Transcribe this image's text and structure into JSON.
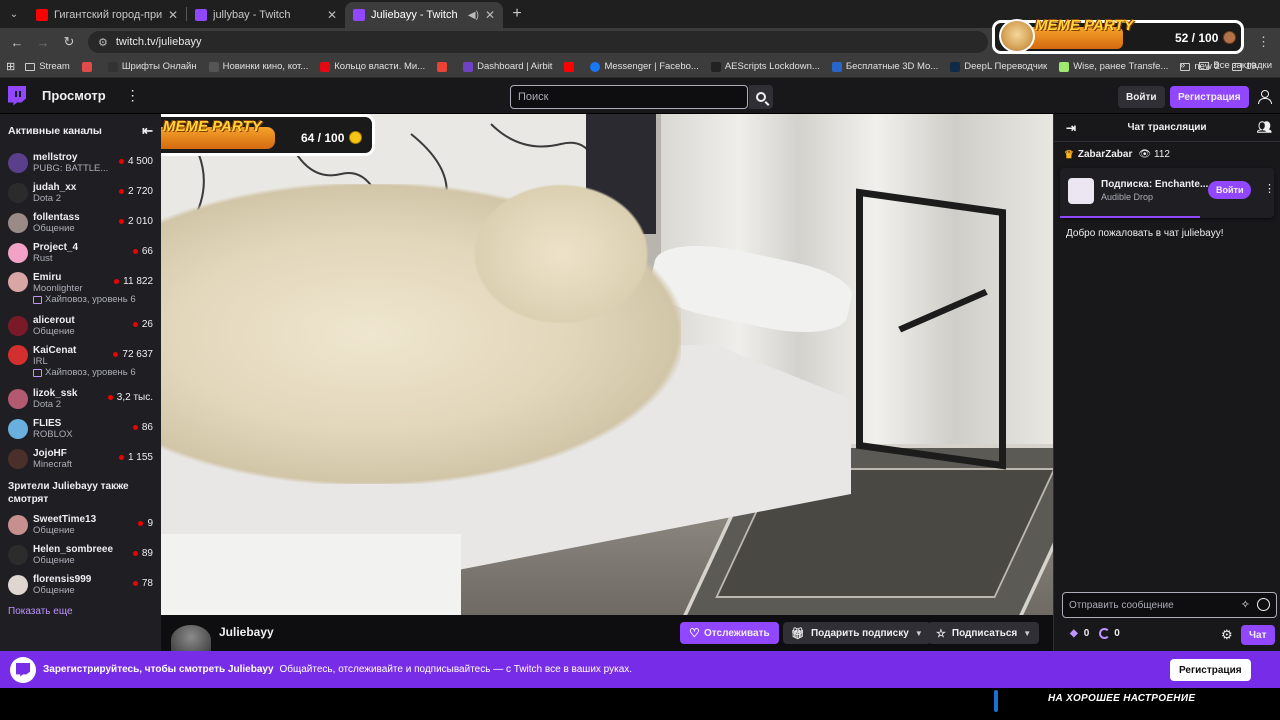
{
  "browser": {
    "tabs": [
      {
        "title": "Гигантский город-призрак СС",
        "favicon_color": "#ff0000",
        "active": false
      },
      {
        "title": "jullybay - Twitch",
        "favicon_color": "#9147ff",
        "active": false
      },
      {
        "title": "Juliebayy - Twitch",
        "favicon_color": "#9147ff",
        "active": true
      }
    ],
    "url": "twitch.tv/juliebayy",
    "bookmarks": [
      {
        "label": "Stream",
        "icon": "folder-icon"
      },
      {
        "label": "",
        "icon": "bookmark-icon",
        "color": "#e34b4b"
      },
      {
        "label": "Шрифты Онлайн",
        "icon": "bookmark-icon",
        "color": "#333333"
      },
      {
        "label": "Новинки кино, кот...",
        "icon": "bookmark-icon",
        "color": "#555555"
      },
      {
        "label": "Кольцо власти. Ми...",
        "icon": "bookmark-icon",
        "color": "#e50914"
      },
      {
        "label": "",
        "icon": "gmail-icon",
        "color": "#ea4335"
      },
      {
        "label": "Dashboard | Airbit",
        "icon": "bookmark-icon",
        "color": "#6f42c1"
      },
      {
        "label": "",
        "icon": "youtube-icon",
        "color": "#ff0000"
      },
      {
        "label": "Messenger | Facebo...",
        "icon": "bookmark-icon",
        "color": "#1877f2"
      },
      {
        "label": "AEScripts Lockdown...",
        "icon": "bookmark-icon",
        "color": "#222222"
      },
      {
        "label": "Бесплатные 3D Мо...",
        "icon": "bookmark-icon",
        "color": "#2a66c9"
      },
      {
        "label": "DeepL Переводчик",
        "icon": "bookmark-icon",
        "color": "#0f2b46"
      },
      {
        "label": "Wise, ранее Transfe...",
        "icon": "bookmark-icon",
        "color": "#9fe870"
      },
      {
        "label": "new 2",
        "icon": "folder-icon"
      },
      {
        "label": "19",
        "icon": "folder-icon"
      }
    ],
    "all_bookmarks": "Все закладки"
  },
  "meme_top": {
    "logo": "MEME PARTY",
    "count": "52 / 100",
    "progress": 0.52
  },
  "nav": {
    "browse": "Просмотр",
    "search_placeholder": "Поиск",
    "login": "Войти",
    "signup": "Регистрация"
  },
  "sidebar": {
    "header": "Активные каналы",
    "channels": [
      {
        "name": "mellstroy",
        "game": "PUBG: BATTLE...",
        "viewers": "4 500",
        "avatar": "#5a3f8a"
      },
      {
        "name": "judah_xx",
        "game": "Dota 2",
        "viewers": "2 720",
        "avatar": "#2b2b2b"
      },
      {
        "name": "follentass",
        "game": "Общение",
        "viewers": "2 010",
        "avatar": "#9a8b86"
      },
      {
        "name": "Project_4",
        "game": "Rust",
        "viewers": "66",
        "avatar": "#f2a2c6"
      },
      {
        "name": "Emiru",
        "game": "Moonlighter",
        "hype": "Хайповоз, уровень 6",
        "viewers": "11 822",
        "avatar": "#d9a5a5"
      },
      {
        "name": "alicerout",
        "game": "Общение",
        "viewers": "26",
        "avatar": "#7a1a28"
      },
      {
        "name": "KaiCenat",
        "game": "IRL",
        "hype": "Хайповоз, уровень 6",
        "viewers": "72 637",
        "avatar": "#d32f2f"
      },
      {
        "name": "lizok_ssk",
        "game": "Dota 2",
        "viewers": "3,2 тыс.",
        "avatar": "#b45a70"
      },
      {
        "name": "FLIES",
        "game": "ROBLOX",
        "viewers": "86",
        "avatar": "#6ab0de"
      },
      {
        "name": "JojoHF",
        "game": "Minecraft",
        "viewers": "1 155",
        "avatar": "#4a2f2a"
      }
    ],
    "also_watch": "Зрители Juliebayy также смотрят",
    "also_channels": [
      {
        "name": "SweetTime13",
        "game": "Общение",
        "viewers": "9",
        "avatar": "#c88f8f"
      },
      {
        "name": "Helen_sombreee",
        "game": "Общение",
        "viewers": "89",
        "avatar": "#2c2c2c"
      },
      {
        "name": "florensis999",
        "game": "Общение",
        "viewers": "78",
        "avatar": "#e0d6d0"
      }
    ],
    "show_more": "Показать еще"
  },
  "player": {
    "meme_logo": "MEME PARTY",
    "meme_count": "64 / 100",
    "meme_progress": 0.64
  },
  "stream": {
    "name": "Juliebayy",
    "follow": "Отслеживать",
    "gift": "Подарить подписку",
    "subscribe": "Подписаться"
  },
  "chat": {
    "title": "Чат трансляции",
    "top_gifter": "ZabarZabar",
    "viewer_count": "112",
    "drop_title": "Подписка: Enchante...",
    "drop_subtitle": "Audible Drop",
    "drop_button": "Войти",
    "welcome": "Добро пожаловать в чат juliebayy!",
    "input_placeholder": "Отправить сообщение",
    "points_a": "0",
    "points_b": "0",
    "chat_button": "Чат"
  },
  "banner": {
    "headline": "Зарегистрируйтесь, чтобы смотреть Juliebayy",
    "text": "Общайтесь, отслеживайте и подписывайтесь — с Twitch все в ваших руках.",
    "button": "Регистрация"
  },
  "bottom_overlay": {
    "text": "НА ХОРОШЕЕ НАСТРОЕНИЕ"
  }
}
